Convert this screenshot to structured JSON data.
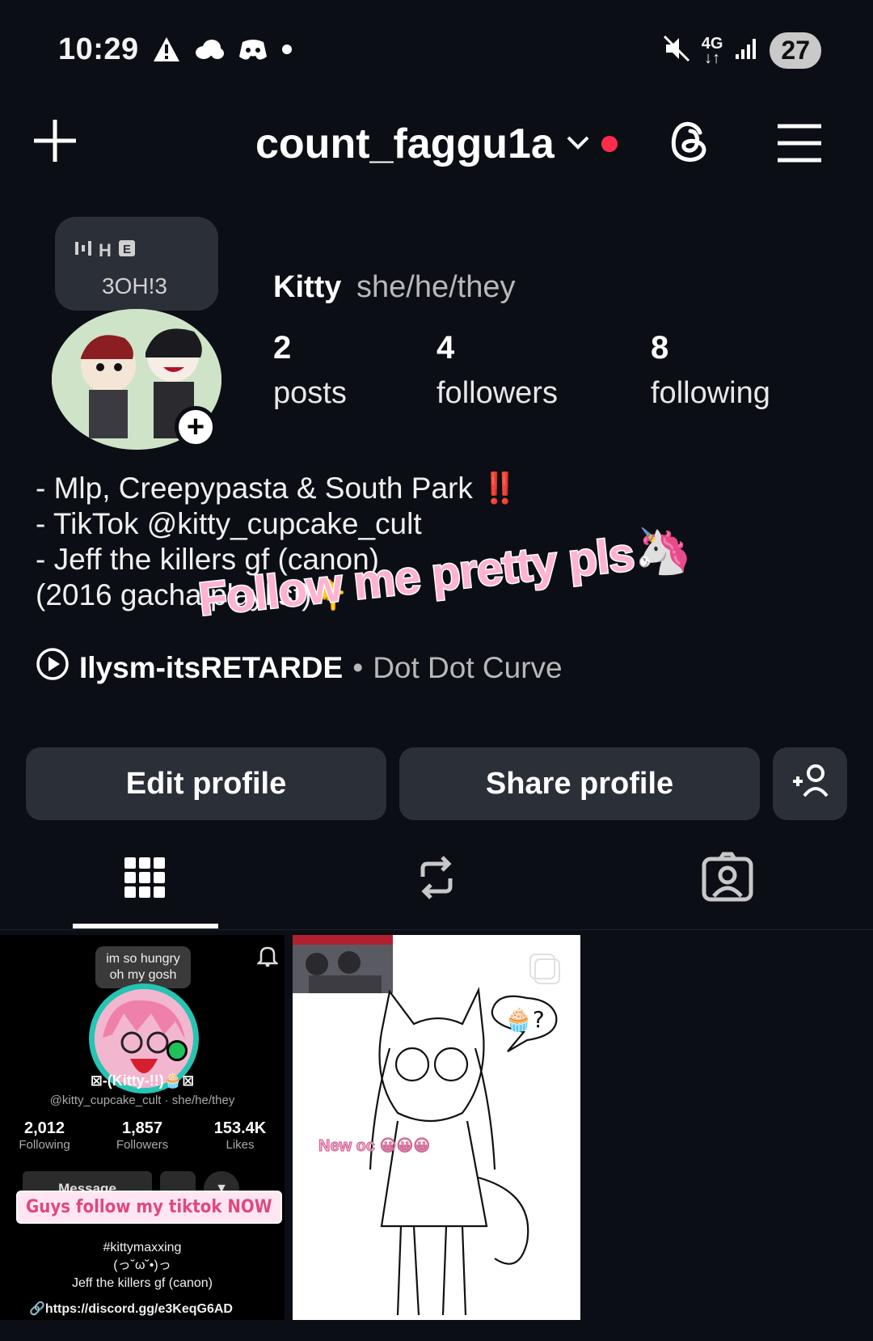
{
  "status_bar": {
    "time": "10:29",
    "network": "4G",
    "battery": "27",
    "icons": [
      "alert-icon",
      "cloud-icon",
      "discord-icon",
      "dot-icon",
      "mute-icon",
      "signal-icon"
    ]
  },
  "top_nav": {
    "username": "count_faggu1a",
    "icons": [
      "plus-icon",
      "chevron-down-icon",
      "threads-icon",
      "menu-icon"
    ]
  },
  "note": {
    "text": "3OH!3",
    "label": "H"
  },
  "profile": {
    "name": "Kitty",
    "pronouns": "she/he/they",
    "stats": {
      "posts_count": "2",
      "posts_label": "posts",
      "followers_count": "4",
      "followers_label": "followers",
      "following_count": "8",
      "following_label": "following"
    },
    "bio": [
      "- Mlp, Creepypasta & South Park ‼️",
      "- TikTok @kitty_cupcake_cult",
      "- Jeff the killers gf (canon)",
      "(2016 gacha playlist)👇"
    ],
    "music": {
      "track": "Ilysm-itsRETARDE",
      "separator": "•",
      "artist": "Dot Dot Curve"
    },
    "overlay_text": "Follow me pretty pls🦄"
  },
  "actions": {
    "edit_label": "Edit profile",
    "share_label": "Share profile"
  },
  "tabs": [
    "grid-tab",
    "reposts-tab",
    "tagged-tab"
  ],
  "posts": {
    "post1": {
      "bubble_line1": "im so hungry",
      "bubble_line2": "oh my gosh",
      "display_name": "⊠-(Kitty-!!)🧁⊠",
      "handle": "@kitty_cupcake_cult · she/he/they",
      "following_count": "2,012",
      "following_label": "Following",
      "followers_count": "1,857",
      "followers_label": "Followers",
      "likes_count": "153.4K",
      "likes_label": "Likes",
      "message_label": "Message",
      "banner": "Guys follow my tiktok NOW",
      "bio_line1": "#kittymaxxing",
      "bio_line2": "(っ˘ω˘•)っ",
      "bio_line3": "Jeff the killers gf (canon)",
      "link": "https://discord.gg/e3KeqG6AD"
    },
    "post2": {
      "caption": "New oc 😀😀😀",
      "thought": "🧁?"
    }
  },
  "colors": {
    "background": "#0b0e14",
    "button": "#2b2f38",
    "accent_red": "#ff2d4b",
    "overlay_pink": "#ffb3d1"
  }
}
